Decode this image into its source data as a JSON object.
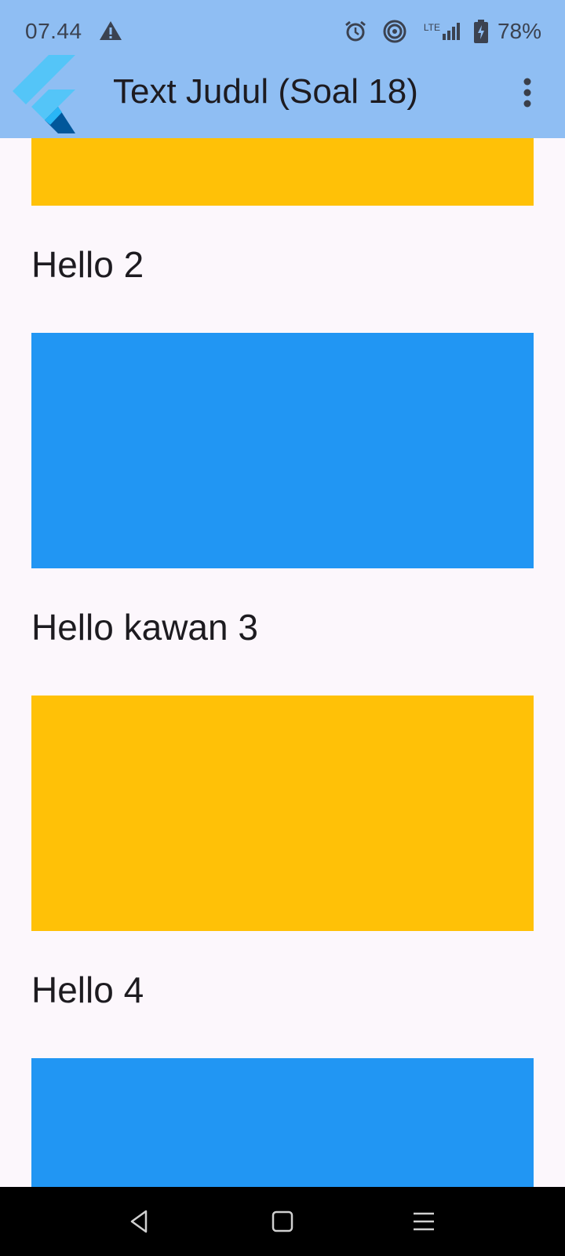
{
  "status_bar": {
    "time": "07.44",
    "battery": "78%",
    "icons": [
      "warning-icon",
      "alarm-icon",
      "hotspot-icon",
      "lte-icon",
      "signal-icon",
      "battery-charging-icon"
    ],
    "lte": "LTE"
  },
  "app_bar": {
    "title": "Text Judul (Soal 18)",
    "logo": "flutter-logo",
    "menu_icon": "more-vert-icon",
    "background": "#8fbef3"
  },
  "list": {
    "items": [
      {
        "type": "block",
        "color": "#ffc107"
      },
      {
        "type": "text",
        "label": "Hello 2"
      },
      {
        "type": "block",
        "color": "#2196f3"
      },
      {
        "type": "text",
        "label": "Hello kawan 3"
      },
      {
        "type": "block",
        "color": "#ffc107"
      },
      {
        "type": "text",
        "label": "Hello 4"
      },
      {
        "type": "block",
        "color": "#2196f3"
      }
    ]
  },
  "nav_bar": {
    "back_icon": "back-icon",
    "home_icon": "home-icon",
    "recents_icon": "recents-icon"
  }
}
